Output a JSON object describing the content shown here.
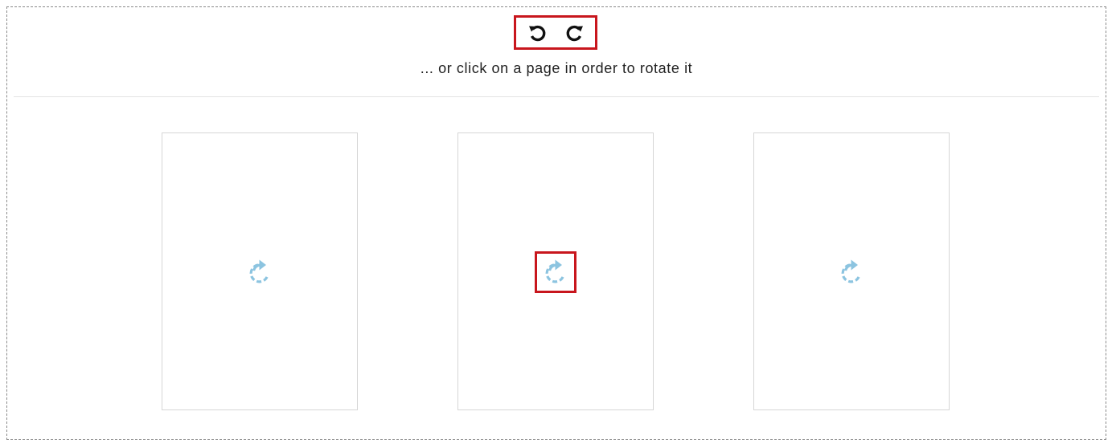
{
  "toolbar": {
    "rotate_left_icon": "rotate-counterclockwise-icon",
    "rotate_right_icon": "rotate-clockwise-icon",
    "hint": "... or click on a page in order to rotate it"
  },
  "pages": [
    {
      "icon": "rotate-page-icon",
      "highlighted": false
    },
    {
      "icon": "rotate-page-icon",
      "highlighted": true
    },
    {
      "icon": "rotate-page-icon",
      "highlighted": false
    }
  ],
  "colors": {
    "highlight": "#c8161d",
    "page_icon": "#8cc4e0",
    "toolbar_icon": "#111111",
    "border": "#8a8a8a"
  }
}
